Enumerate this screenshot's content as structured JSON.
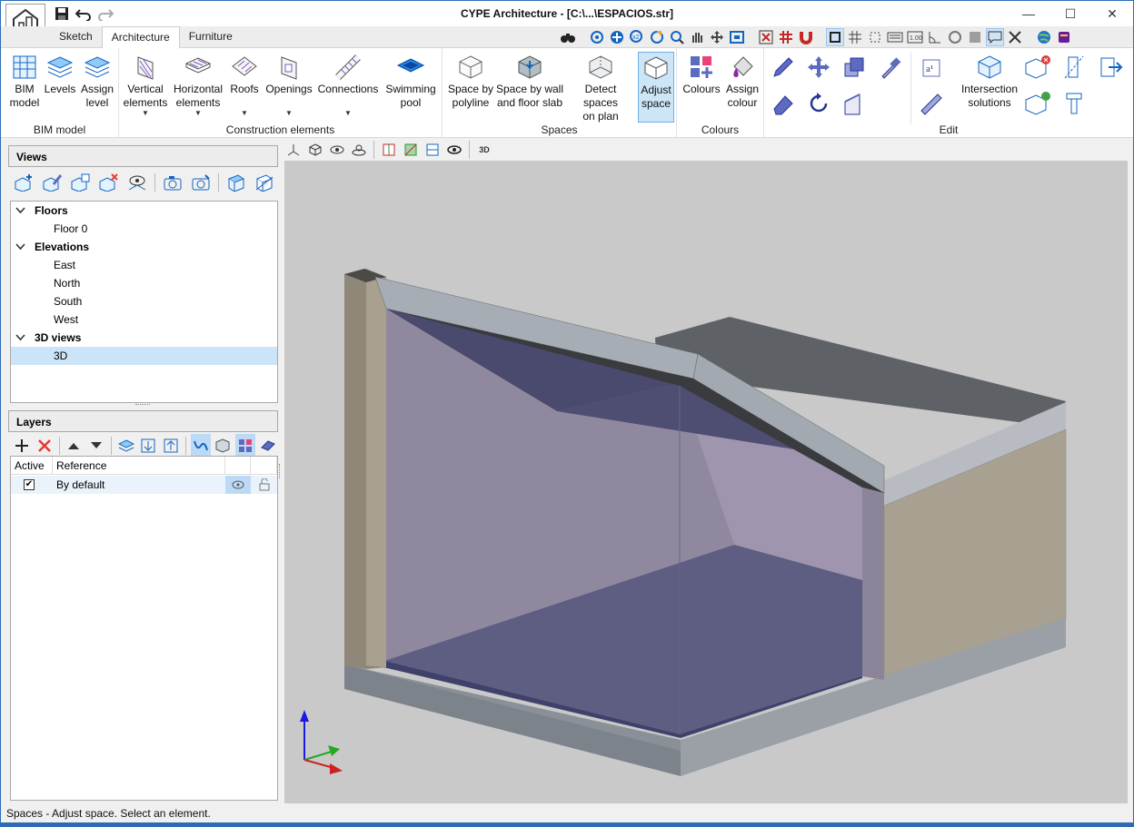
{
  "window": {
    "title": "CYPE Architecture - [C:\\...\\ESPACIOS.str]",
    "minimize_glyph": "—",
    "maximize_glyph": "☐",
    "close_glyph": "✕"
  },
  "tabs": [
    {
      "label": "Sketch",
      "active": false
    },
    {
      "label": "Architecture",
      "active": true
    },
    {
      "label": "Furniture",
      "active": false
    }
  ],
  "ribbon": {
    "groups": [
      {
        "label": "BIM model"
      },
      {
        "label": "Construction elements"
      },
      {
        "label": "Spaces"
      },
      {
        "label": "Colours"
      },
      {
        "label": "Edit"
      }
    ],
    "buttons": {
      "bim_model": [
        "BIM",
        "model"
      ],
      "levels": "Levels",
      "assign_level": [
        "Assign",
        "level"
      ],
      "vertical_elements": [
        "Vertical",
        "elements"
      ],
      "horizontal_elements": [
        "Horizontal",
        "elements"
      ],
      "roofs": "Roofs",
      "openings": "Openings",
      "connections": "Connections",
      "swimming_pool": [
        "Swimming",
        "pool"
      ],
      "space_by_polyline": [
        "Space by",
        "polyline"
      ],
      "space_by_wall": [
        "Space by wall",
        "and floor slab"
      ],
      "detect_spaces": [
        "Detect spaces",
        "on plan"
      ],
      "adjust_space": [
        "Adjust",
        "space"
      ],
      "colours": "Colours",
      "assign_colour": [
        "Assign",
        "colour"
      ],
      "intersection_solutions": [
        "Intersection",
        "solutions"
      ]
    }
  },
  "views_panel": {
    "title": "Views",
    "tree": [
      {
        "label": "Floors",
        "level": 0
      },
      {
        "label": "Floor 0",
        "level": 1
      },
      {
        "label": "Elevations",
        "level": 0
      },
      {
        "label": "East",
        "level": 1
      },
      {
        "label": "North",
        "level": 1
      },
      {
        "label": "South",
        "level": 1
      },
      {
        "label": "West",
        "level": 1
      },
      {
        "label": "3D views",
        "level": 0
      },
      {
        "label": "3D",
        "level": 1,
        "selected": true
      }
    ]
  },
  "layers_panel": {
    "title": "Layers",
    "columns": [
      "Active",
      "Reference"
    ],
    "rows": [
      {
        "active": true,
        "reference": "By default"
      }
    ]
  },
  "toolbar2_badge": "3D",
  "status": "Spaces - Adjust space. Select an element.",
  "colors": {
    "accent": "#2d6cb5",
    "selection": "#cce4f7",
    "viewport_bg": "#c9c9c9"
  }
}
